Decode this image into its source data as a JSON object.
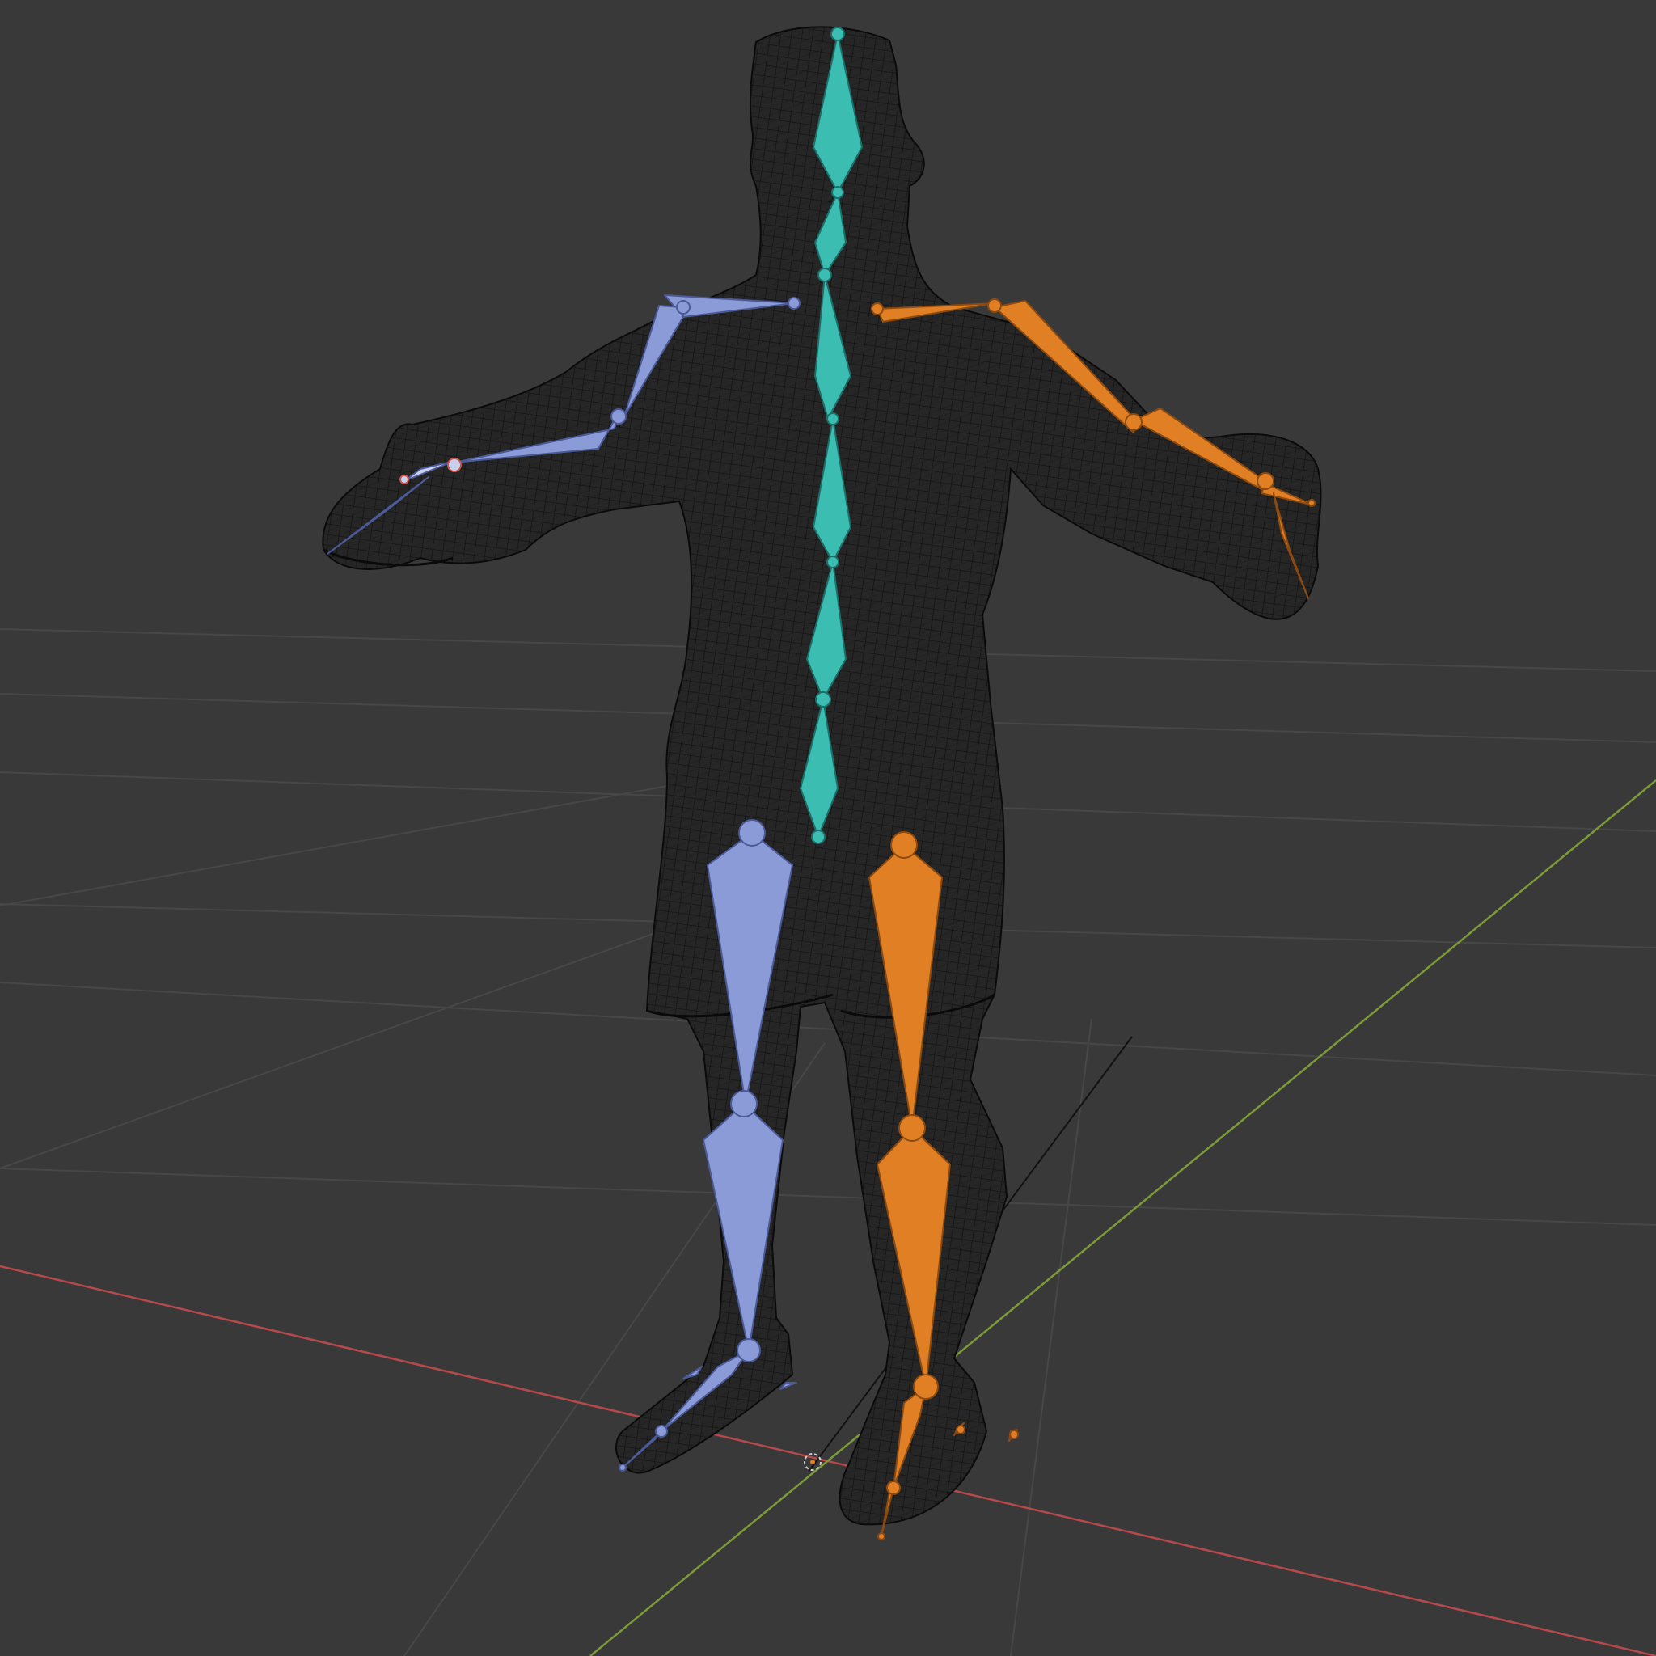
{
  "viewport": {
    "background": "#393939",
    "grid_color": "#4a4a4a",
    "x_axis_color": "#b5494b",
    "y_axis_color": "#7c9a38"
  },
  "mesh": {
    "fill": "#262626",
    "wire_color": "#0d0d0d",
    "outline_color": "#0a0a0a"
  },
  "armature": {
    "center_color": "#3bbdb2",
    "left_color": "#8a9bd8",
    "right_color": "#e07f23"
  }
}
